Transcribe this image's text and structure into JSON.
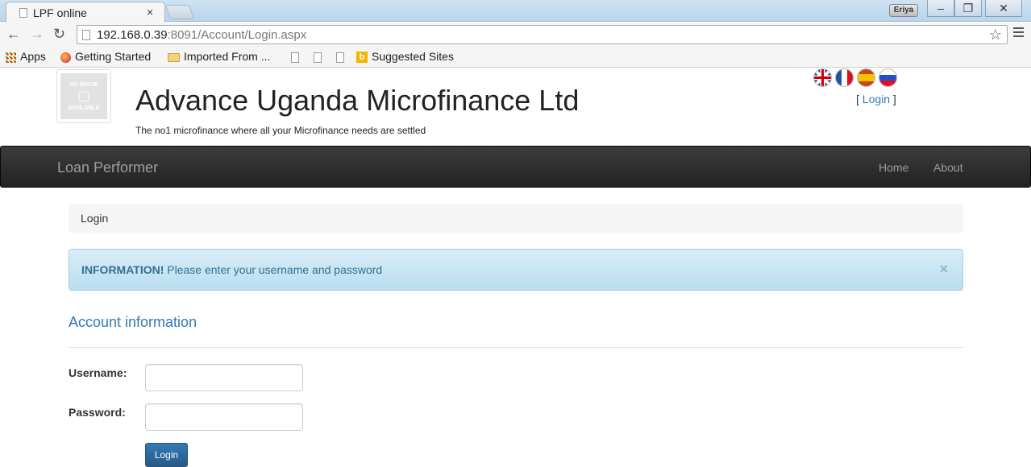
{
  "browser": {
    "tab_title": "LPF online",
    "tab_close": "×",
    "profile_name": "Eriya",
    "url_host": "192.168.0.39",
    "url_rest": ":8091/Account/Login.aspx",
    "bookmarks": [
      "Apps",
      "Getting Started",
      "Imported From ...",
      "Suggested Sites"
    ]
  },
  "header": {
    "logo_text_1": "NO IMAGE",
    "logo_text_2": "AVAILABLE",
    "title": "Advance Uganda Microfinance Ltd",
    "subtitle": "The no1 microfinance where all your Microfinance needs are settled",
    "login_prefix": "[ ",
    "login_link": "Login",
    "login_suffix": " ]"
  },
  "navbar": {
    "brand": "Loan Performer",
    "links": [
      "Home",
      "About"
    ]
  },
  "breadcrumb": "Login",
  "alert": {
    "strong": "INFORMATION!",
    "text": " Please enter your username and password",
    "close": "×",
    "color": "#d9edf7"
  },
  "form": {
    "section_title": "Account information",
    "username_label": "Username:",
    "username_value": "",
    "password_label": "Password:",
    "password_value": "",
    "submit_label": "Login"
  },
  "colors": {
    "link": "#337ab7",
    "navbar": "#222222",
    "button": "#337ab7"
  }
}
